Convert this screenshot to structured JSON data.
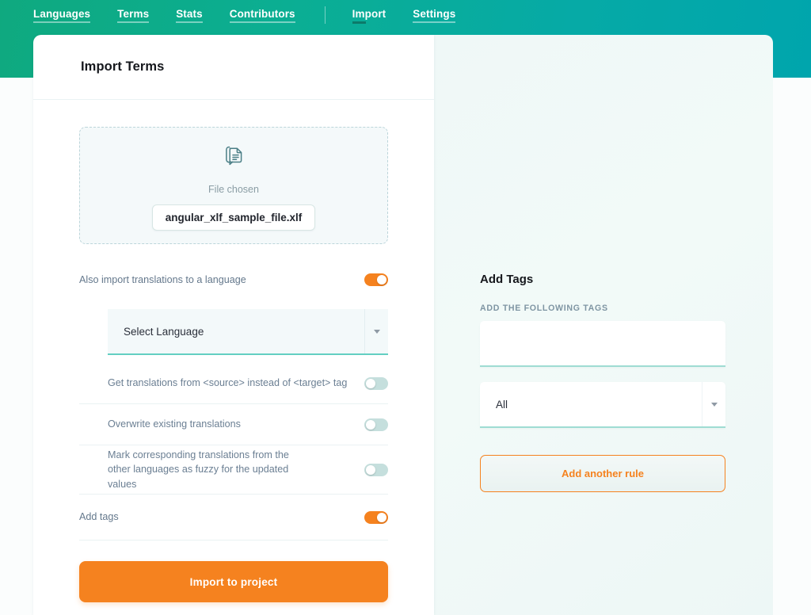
{
  "nav": {
    "items": [
      {
        "label": "Languages",
        "active": false
      },
      {
        "label": "Terms",
        "active": false
      },
      {
        "label": "Stats",
        "active": false
      },
      {
        "label": "Contributors",
        "active": false
      }
    ],
    "items_right": [
      {
        "label": "Import",
        "active": true
      },
      {
        "label": "Settings",
        "active": false
      }
    ]
  },
  "card": {
    "title": "Import Terms"
  },
  "dropzone": {
    "icon": "document-comment-icon",
    "status_label": "File chosen",
    "file_name": "angular_xlf_sample_file.xlf"
  },
  "options": [
    {
      "label": "Also import translations to a language",
      "state": "on"
    },
    {
      "label": "Get translations from <source> instead of <target> tag",
      "state": "off"
    },
    {
      "label": "Overwrite existing translations",
      "state": "off"
    },
    {
      "label": "Mark corresponding translations from the other languages as fuzzy for the updated values",
      "state": "off"
    },
    {
      "label": "Add tags",
      "state": "on"
    }
  ],
  "language_select": {
    "value": "Select Language",
    "icon": "chevron-down-icon"
  },
  "import_button": {
    "label": "Import to project"
  },
  "right_panel": {
    "title": "Add Tags",
    "sublabel": "ADD THE FOLLOWING TAGS",
    "tags_input": {
      "value": "",
      "placeholder": ""
    },
    "rule_select": {
      "value": "All",
      "icon": "chevron-down-icon"
    },
    "add_rule_button": {
      "label": "Add another rule"
    }
  },
  "colors": {
    "header_gradient_start": "#0fa97f",
    "header_gradient_end": "#00a5ad",
    "accent_orange": "#f5821f",
    "toggle_off": "#c5dfdd",
    "underline_teal": "#63cfc2"
  }
}
